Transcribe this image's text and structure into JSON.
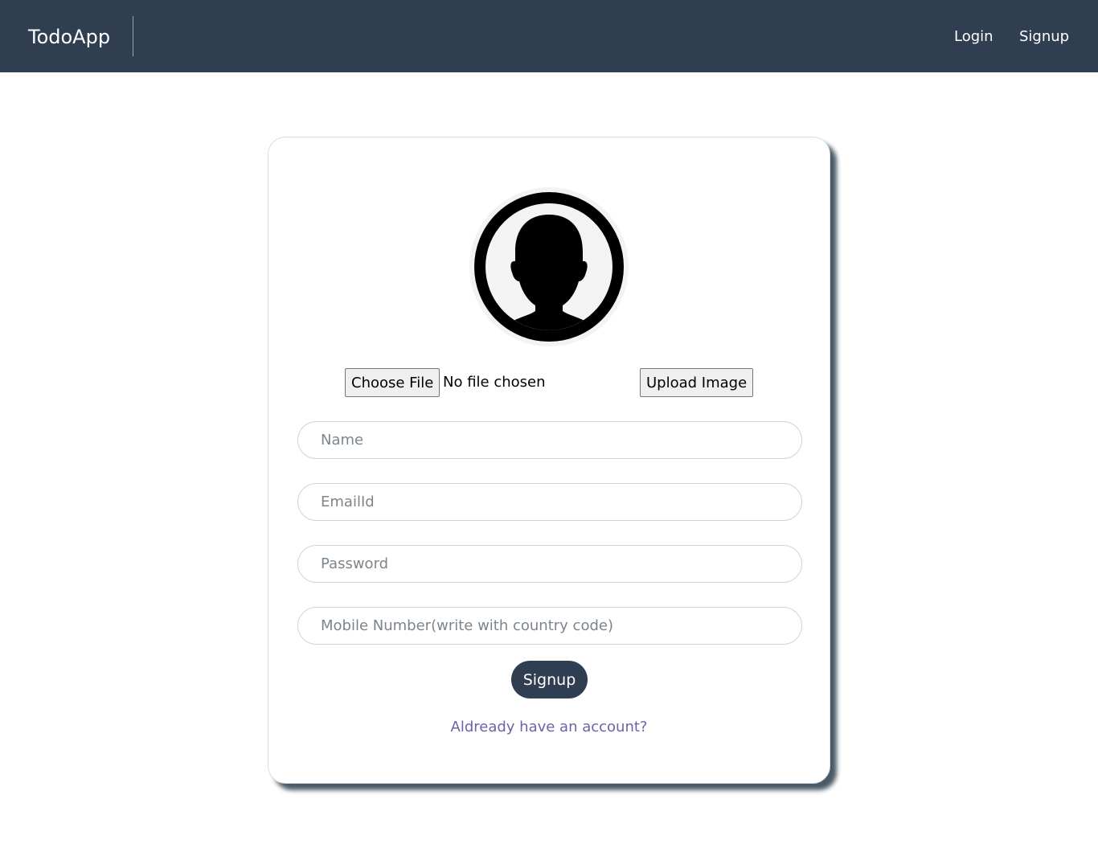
{
  "navbar": {
    "brand": "TodoApp",
    "links": [
      {
        "label": "Login"
      },
      {
        "label": "Signup"
      }
    ]
  },
  "signup_card": {
    "avatar_icon": "user-silhouette-icon",
    "file_picker": {
      "button_label": "Choose File",
      "status": "No file chosen"
    },
    "upload_button": "Upload Image",
    "fields": {
      "name": {
        "placeholder": "Name",
        "value": ""
      },
      "email": {
        "placeholder": "EmailId",
        "value": ""
      },
      "password": {
        "placeholder": "Password",
        "value": ""
      },
      "mobile": {
        "placeholder": "Mobile Number(write with country code)",
        "value": ""
      }
    },
    "submit_label": "Signup",
    "login_link": "Aldready have an account?"
  },
  "colors": {
    "navbar_bg": "#2f3e50",
    "button_bg": "#2f3e50",
    "link": "#6a63a8"
  }
}
